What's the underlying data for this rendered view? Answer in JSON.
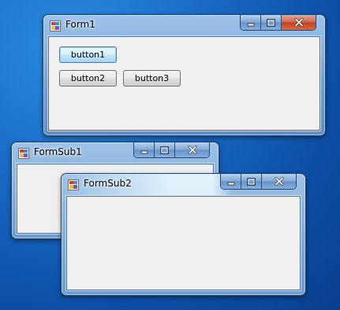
{
  "form1": {
    "title": "Form1",
    "buttons": {
      "button1": "button1",
      "button2": "button2",
      "button3": "button3"
    }
  },
  "formsub1": {
    "title": "FormSub1"
  },
  "formsub2": {
    "title": "FormSub2"
  },
  "icons": {
    "app": "winforms-app-icon",
    "minimize": "minimize-icon",
    "maximize": "maximize-icon",
    "close": "close-icon"
  },
  "colors": {
    "desktop": "#1a6cc8",
    "close_active": "#c04020",
    "client": "#f0f0f0"
  }
}
